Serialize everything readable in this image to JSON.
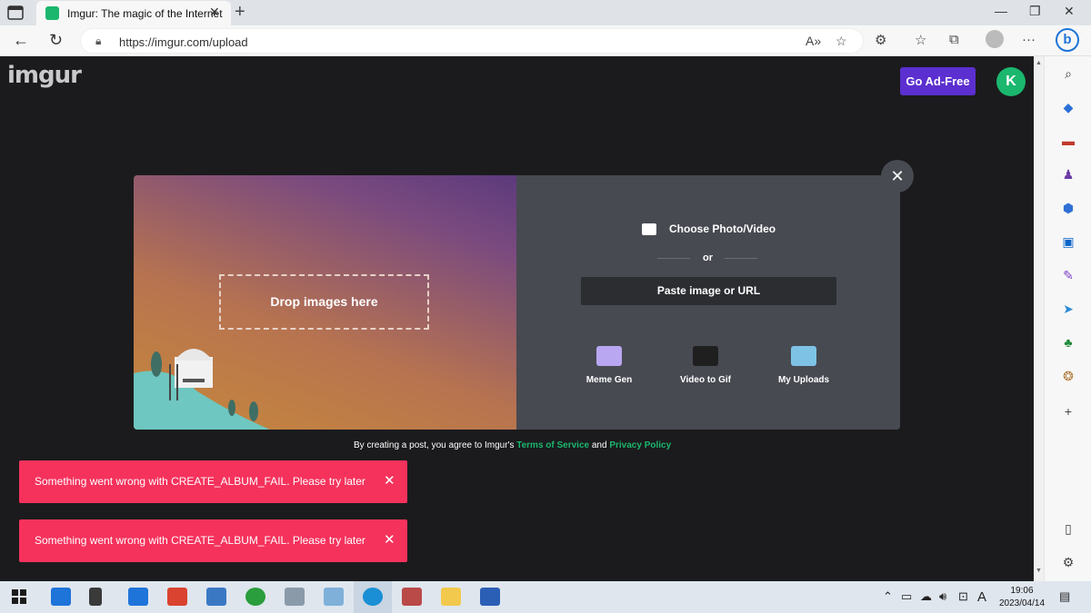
{
  "browser": {
    "tab_title": "Imgur: The magic of the Internet",
    "tab_close": "✕",
    "new_tab": "+",
    "url": "https://imgur.com/upload"
  },
  "header": {
    "logo": "imgur",
    "go_ad_free": "Go Ad-Free",
    "avatar_initial": "K"
  },
  "upload": {
    "drop_label": "Drop images here",
    "choose_label": "Choose Photo/Video",
    "or_label": "or",
    "paste_label": "Paste image or URL",
    "tools": [
      {
        "label": "Meme Gen",
        "icon": "meme-gen-icon"
      },
      {
        "label": "Video to Gif",
        "icon": "video-to-gif-icon"
      },
      {
        "label": "My Uploads",
        "icon": "my-uploads-icon"
      }
    ],
    "close": "✕"
  },
  "terms": {
    "prefix": "By creating a post, you agree to Imgur's ",
    "tos": "Terms of Service",
    "and": " and ",
    "privacy": "Privacy Policy"
  },
  "toasts": [
    {
      "message": "Something went wrong with CREATE_ALBUM_FAIL. Please try later",
      "close": "✕"
    },
    {
      "message": "Something went wrong with CREATE_ALBUM_FAIL. Please try later",
      "close": "✕"
    }
  ],
  "taskbar": {
    "time": "19:06",
    "date": "2023/04/14",
    "ime": "A"
  },
  "colors": {
    "brand_green": "#1bb76e",
    "ad_free_purple": "#5b2fd0",
    "toast_red": "#f5325c",
    "page_bg": "#1b1b1d"
  }
}
